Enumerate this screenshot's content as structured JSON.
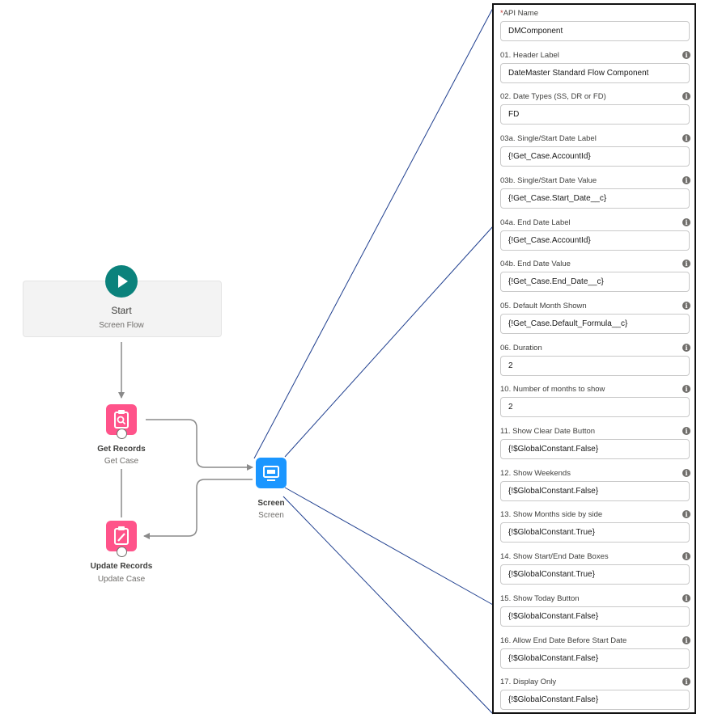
{
  "flow": {
    "start": {
      "title": "Start",
      "subtitle": "Screen Flow"
    },
    "get_records": {
      "title": "Get Records",
      "subtitle": "Get Case"
    },
    "update_records": {
      "title": "Update Records",
      "subtitle": "Update Case"
    },
    "screen": {
      "title": "Screen",
      "subtitle": "Screen"
    }
  },
  "panel": {
    "required_marker": "*",
    "fields": [
      {
        "label": "API Name",
        "value": "DMComponent",
        "required": true,
        "info": false
      },
      {
        "label": "01. Header Label",
        "value": "DateMaster Standard Flow Component",
        "info": true
      },
      {
        "label": "02. Date Types (SS, DR or FD)",
        "value": "FD",
        "info": true
      },
      {
        "label": "03a. Single/Start Date Label",
        "value": "{!Get_Case.AccountId}",
        "info": true
      },
      {
        "label": "03b. Single/Start Date Value",
        "value": "{!Get_Case.Start_Date__c}",
        "info": true
      },
      {
        "label": "04a. End Date Label",
        "value": "{!Get_Case.AccountId}",
        "info": true
      },
      {
        "label": "04b. End Date Value",
        "value": "{!Get_Case.End_Date__c}",
        "info": true
      },
      {
        "label": "05. Default Month Shown",
        "value": "{!Get_Case.Default_Formula__c}",
        "info": true
      },
      {
        "label": "06. Duration",
        "value": "2",
        "info": true
      },
      {
        "label": "10. Number of months to show",
        "value": "2",
        "info": true
      },
      {
        "label": "11. Show Clear Date Button",
        "value": "{!$GlobalConstant.False}",
        "info": true
      },
      {
        "label": "12. Show Weekends",
        "value": "{!$GlobalConstant.False}",
        "info": true
      },
      {
        "label": "13. Show Months side by side",
        "value": "{!$GlobalConstant.True}",
        "info": true
      },
      {
        "label": "14. Show Start/End Date Boxes",
        "value": "{!$GlobalConstant.True}",
        "info": true
      },
      {
        "label": "15. Show Today Button",
        "value": "{!$GlobalConstant.False}",
        "info": true
      },
      {
        "label": "16. Allow End Date Before Start Date",
        "value": "{!$GlobalConstant.False}",
        "info": true
      },
      {
        "label": "17. Display Only",
        "value": "{!$GlobalConstant.False}",
        "info": true
      }
    ]
  },
  "icons": {
    "start": "play-icon",
    "get_records": "clipboard-search-icon",
    "update_records": "clipboard-edit-icon",
    "screen": "monitor-icon",
    "info": "info-icon"
  },
  "colors": {
    "start_icon": "#0b827c",
    "record_icon": "#ff538a",
    "screen_icon": "#1b96ff",
    "connector": "#8a8a8a",
    "callout_line": "#1f3f8f"
  }
}
